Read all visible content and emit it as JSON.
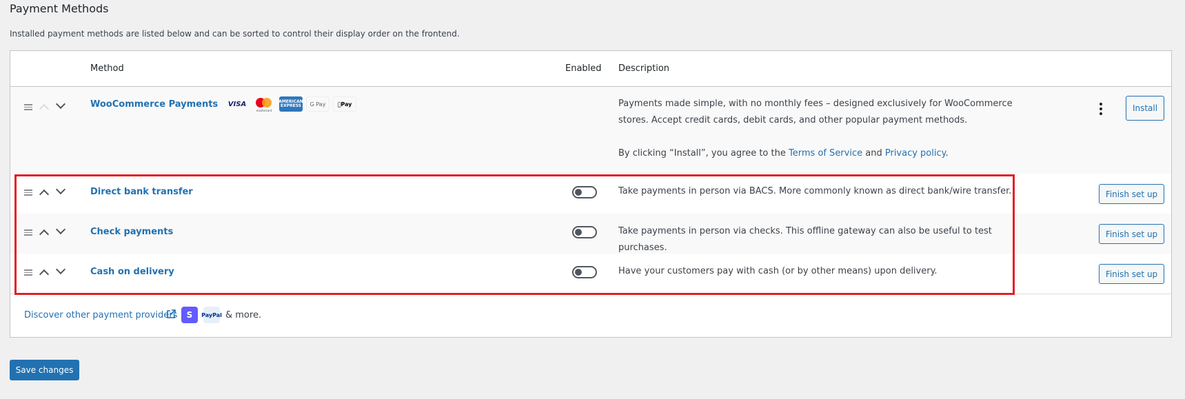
{
  "section": {
    "title": "Payment Methods",
    "description": "Installed payment methods are listed below and can be sorted to control their display order on the frontend."
  },
  "table": {
    "headers": {
      "method": "Method",
      "enabled": "Enabled",
      "description": "Description"
    },
    "rows": [
      {
        "name": "WooCommerce Payments",
        "logos": [
          "visa-logo",
          "mastercard-logo",
          "amex-logo",
          "google-pay-logo",
          "apple-pay-logo"
        ],
        "logo_text": {
          "visa": "VISA",
          "mastercard": "mastercard",
          "amex": "AMERICAN EXPRESS",
          "gpay": "G Pay",
          "apay": "Pay"
        },
        "description": "Payments made simple, with no monthly fees – designed exclusively for WooCommerce stores. Accept credit cards, debit cards, and other popular payment methods.",
        "agree_prefix": "By clicking “Install”, you agree to the",
        "terms_link": "Terms of Service",
        "and": "and",
        "privacy_link": "Privacy policy",
        "agree_suffix": ".",
        "action": "Install",
        "up_disabled": true
      },
      {
        "name": "Direct bank transfer",
        "enabled": false,
        "description": "Take payments in person via BACS. More commonly known as direct bank/wire transfer.",
        "action": "Finish set up"
      },
      {
        "name": "Check payments",
        "enabled": false,
        "description": "Take payments in person via checks. This offline gateway can also be useful to test purchases.",
        "action": "Finish set up"
      },
      {
        "name": "Cash on delivery",
        "enabled": false,
        "description": "Have your customers pay with cash (or by other means) upon delivery.",
        "action": "Finish set up"
      }
    ],
    "footer": {
      "discover_link": "Discover other payment providers",
      "providers": [
        "stripe-icon",
        "paypal-icon"
      ],
      "provider_text": {
        "stripe": "S",
        "paypal": "PayPal"
      },
      "more_text": "& more."
    }
  },
  "save_button": "Save changes",
  "colors": {
    "accent": "#2271b1",
    "highlight": "#e31e24",
    "background": "#f0f0f1"
  }
}
